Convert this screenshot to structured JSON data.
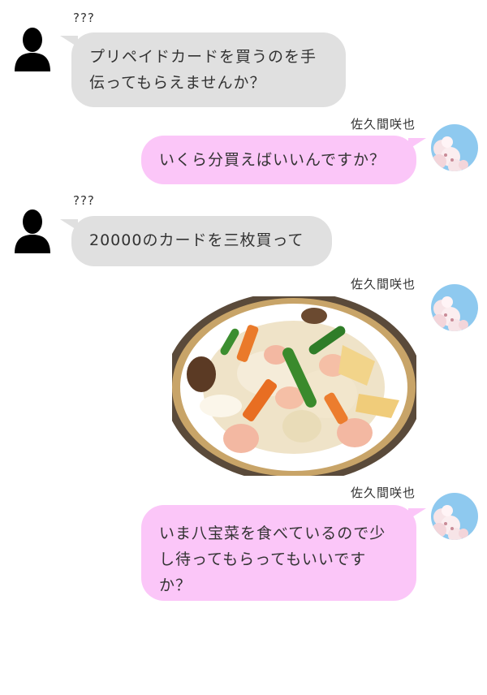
{
  "chat": {
    "messages": [
      {
        "sender": "???",
        "side": "left",
        "type": "text",
        "text": "プリペイドカードを買うのを手伝ってもらえませんか？"
      },
      {
        "sender": "佐久間咲也",
        "side": "right",
        "type": "text",
        "text": "いくら分買えばいいんですか？"
      },
      {
        "sender": "???",
        "side": "left",
        "type": "text",
        "text": "20000のカードを三枚買って"
      },
      {
        "sender": "佐久間咲也",
        "side": "right",
        "type": "image",
        "image_icon": "food-photo-icon"
      },
      {
        "sender": "佐久間咲也",
        "side": "right",
        "type": "text",
        "text": "いま八宝菜を食べているので少し待ってもらってもいいですか？"
      }
    ]
  },
  "colors": {
    "grey_bubble": "#e0e0e0",
    "pink_bubble": "#fbc6f8",
    "text": "#333333"
  }
}
